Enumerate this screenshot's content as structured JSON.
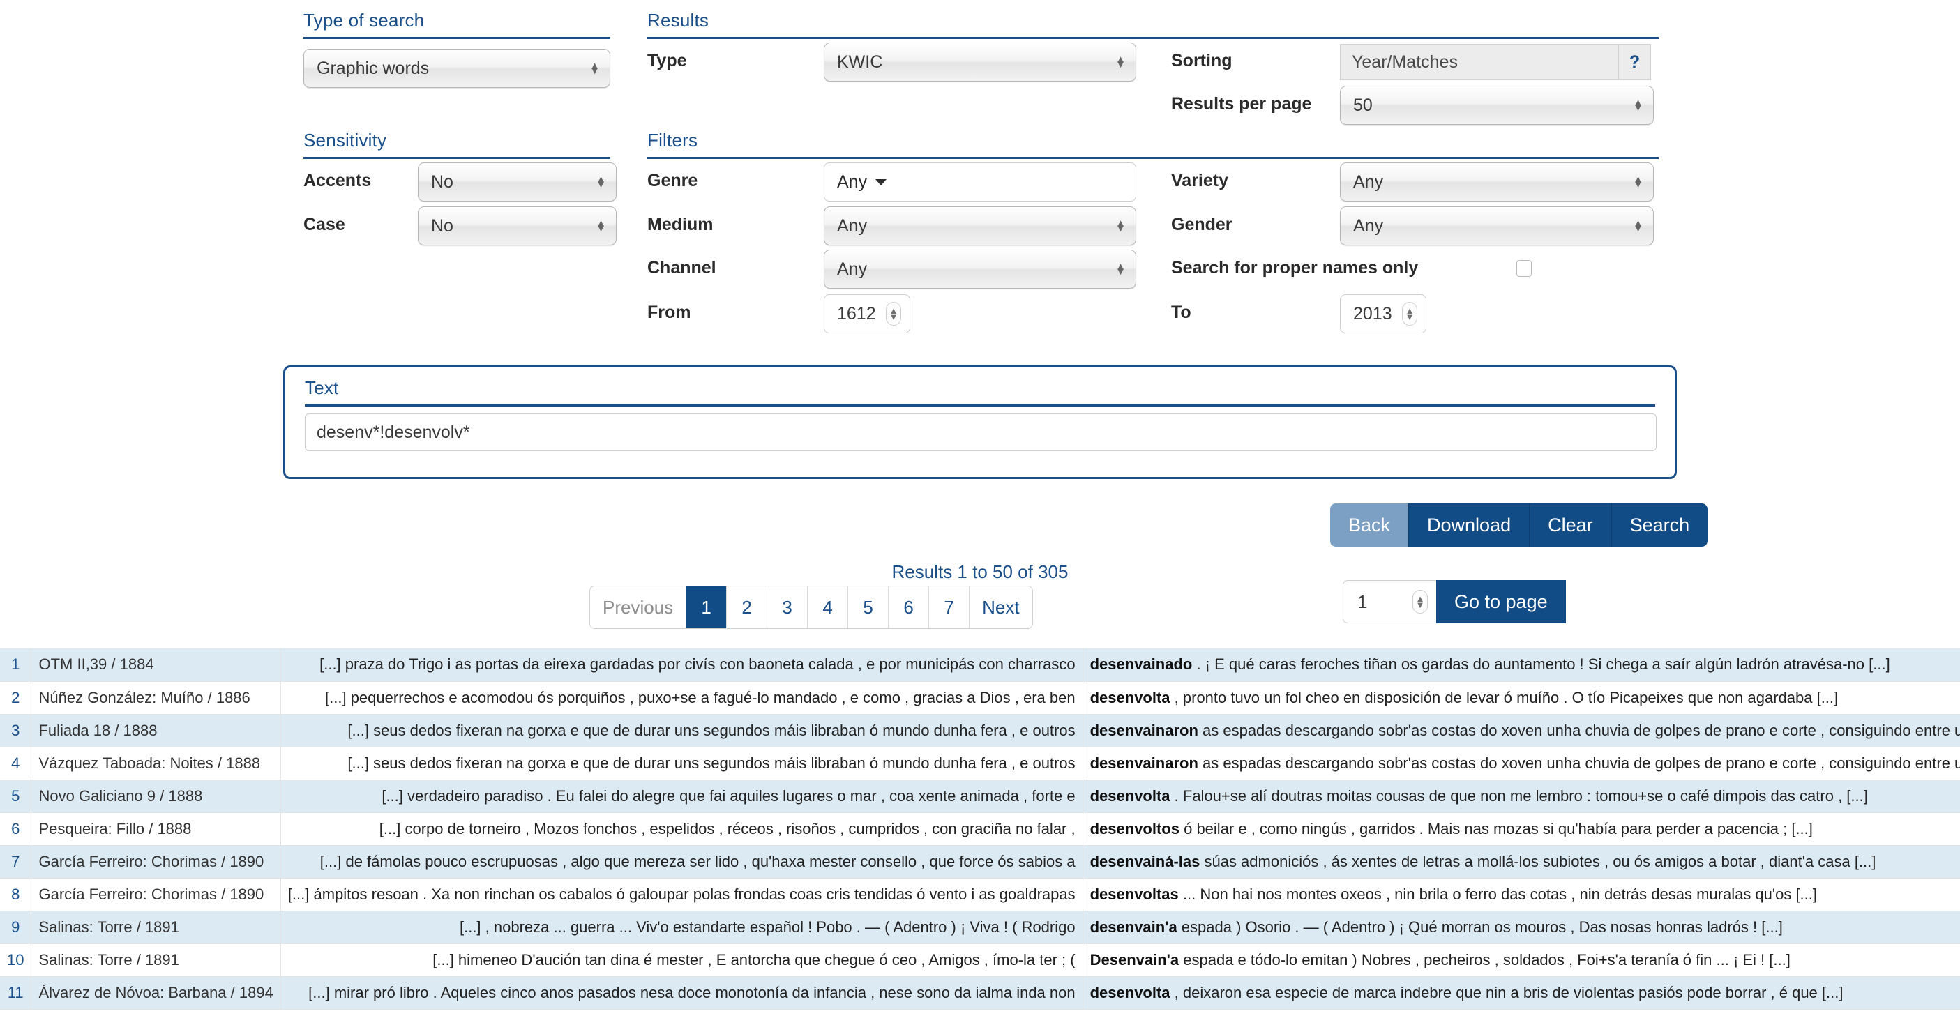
{
  "search_form": {
    "type_of_search": {
      "legend": "Type of search",
      "value": "Graphic words"
    },
    "sensitivity": {
      "legend": "Sensitivity",
      "accents_label": "Accents",
      "accents_value": "No",
      "case_label": "Case",
      "case_value": "No"
    },
    "results": {
      "legend": "Results",
      "type_label": "Type",
      "type_value": "KWIC",
      "sorting_label": "Sorting",
      "sorting_value": "Year/Matches",
      "help_label": "?",
      "per_page_label": "Results per page",
      "per_page_value": "50"
    },
    "filters": {
      "legend": "Filters",
      "genre_label": "Genre",
      "genre_value": "Any",
      "medium_label": "Medium",
      "medium_value": "Any",
      "channel_label": "Channel",
      "channel_value": "Any",
      "from_label": "From",
      "from_value": "1612",
      "to_label": "To",
      "to_value": "2013",
      "variety_label": "Variety",
      "variety_value": "Any",
      "gender_label": "Gender",
      "gender_value": "Any",
      "proper_names_label": "Search for proper names only",
      "proper_names_checked": false
    },
    "text": {
      "legend": "Text",
      "value": "desenv*!desenvolv*"
    },
    "buttons": {
      "back": "Back",
      "download": "Download",
      "clear": "Clear",
      "search": "Search"
    }
  },
  "results": {
    "count_text": "Results 1 to 50 of 305",
    "pagination": {
      "previous": "Previous",
      "pages": [
        "1",
        "2",
        "3",
        "4",
        "5",
        "6",
        "7"
      ],
      "active_page": "1",
      "next": "Next"
    },
    "goto": {
      "value": "1",
      "button": "Go to page"
    },
    "rows": [
      {
        "num": "1",
        "ref": "OTM II,39 / 1884",
        "left": "[...] praza do Trigo i as portas da eirexa gardadas por civís con baoneta calada , e por municipás con charrasco",
        "keyword": "desenvainado",
        "right": ". ¡ E qué caras feroches tiñan os gardas do auntamento ! Si chega a saír algún ladrón atravésa-no [...]"
      },
      {
        "num": "2",
        "ref": "Núñez González: Muíño / 1886",
        "left": "[...] pequerrechos e acomodou ós porquiños , puxo+se a fagué-lo mandado , e como , gracias a Dios , era ben",
        "keyword": "desenvolta",
        "right": ", pronto tuvo un fol cheo en disposición de levar ó muíño . O tío Picapeixes que non agardaba [...]"
      },
      {
        "num": "3",
        "ref": "Fuliada 18 / 1888",
        "left": "[...] seus dedos fixeran na gorxa e que de durar uns segundos máis libraban ó mundo dunha fera , e outros",
        "keyword": "desenvainaron",
        "right": "as espadas descargando sobr'as costas do xoven unha chuvia de golpes de prano e corte , consiguindo entre u"
      },
      {
        "num": "4",
        "ref": "Vázquez Taboada: Noites / 1888",
        "left": "[...] seus dedos fixeran na gorxa e que de durar uns segundos máis libraban ó mundo dunha fera , e outros",
        "keyword": "desenvainaron",
        "right": "as espadas descargando sobr'as costas do xoven unha chuvia de golpes de prano e corte , consiguindo entre u"
      },
      {
        "num": "5",
        "ref": "Novo Galiciano 9 / 1888",
        "left": "[...] verdadeiro paradiso . Eu falei do alegre que fai aquiles lugares o mar , coa xente animada , forte e",
        "keyword": "desenvolta",
        "right": ". Falou+se alí doutras moitas cousas de que non me lembro : tomou+se o café dimpois das catro , [...]"
      },
      {
        "num": "6",
        "ref": "Pesqueira: Fillo / 1888",
        "left": "[...] corpo de torneiro , Mozos fonchos , espelidos , réceos , risoños , cumpridos , con graciña no falar ,",
        "keyword": "desenvoltos",
        "right": "ó beilar e , como ningús , garridos . Mais nas mozas si qu'había para perder a pacencia ; [...]"
      },
      {
        "num": "7",
        "ref": "García Ferreiro: Chorimas / 1890",
        "left": "[...] de fámolas pouco escrupuosas , algo que mereza ser lido , qu'haxa mester consello , que force ós sabios a",
        "keyword": "desenvainá-las",
        "right": "súas admoniciós , ás xentes de letras a mollá-los subiotes , ou ós amigos a botar , diant'a casa [...]"
      },
      {
        "num": "8",
        "ref": "García Ferreiro: Chorimas / 1890",
        "left": "[...] ámpitos resoan . Xa non rinchan os cabalos ó galoupar polas frondas coas cris tendidas ó vento i as goaldrapas",
        "keyword": "desenvoltas",
        "right": "... Non hai nos montes oxeos , nin brila o ferro das cotas , nin detrás desas muralas qu'os [...]"
      },
      {
        "num": "9",
        "ref": "Salinas: Torre / 1891",
        "left": "[...] , nobreza ... guerra ... Viv'o estandarte español ! Pobo . — ( Adentro ) ¡ Viva ! ( Rodrigo",
        "keyword": "desenvain'a",
        "right": "espada ) Osorio . — ( Adentro ) ¡ Qué morran os mouros , Das nosas honras ladrós ! [...]"
      },
      {
        "num": "10",
        "ref": "Salinas: Torre / 1891",
        "left": "[...] himeneo D'aución tan dina é mester , E antorcha que chegue ó ceo , Amigos , ímo-la ter ; (",
        "keyword": "Desenvain'a",
        "right": "espada e tódo-lo emitan ) Nobres , pecheiros , soldados , Foi+s'a teranía ó fin ... ¡ Ei ! [...]"
      },
      {
        "num": "11",
        "ref": "Álvarez de Nóvoa: Barbana / 1894",
        "left": "[...] mirar pró libro . Aqueles cinco anos pasados nesa doce monotonía da infancia , nese sono da ialma inda non",
        "keyword": "desenvolta",
        "right": ", deixaron esa especie de marca indebre que nin a bris de violentas pasiós pode borrar , é que [...]"
      }
    ]
  }
}
